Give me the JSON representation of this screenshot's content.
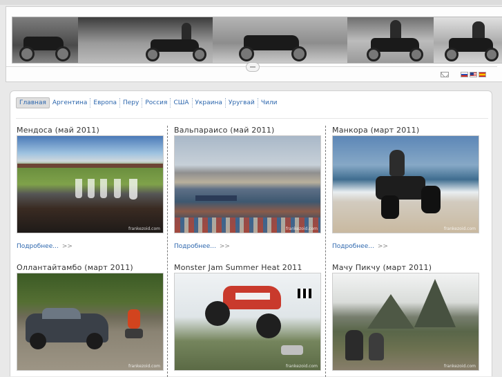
{
  "header": {
    "banner_name": "motorcycle-banner",
    "contact_icon": "mail-icon",
    "languages": [
      "ru",
      "us",
      "es"
    ]
  },
  "nav": {
    "items": [
      {
        "label": "Главная",
        "active": true
      },
      {
        "label": "Аргентина"
      },
      {
        "label": "Европа"
      },
      {
        "label": "Перу"
      },
      {
        "label": "Россия"
      },
      {
        "label": "США"
      },
      {
        "label": "Украина"
      },
      {
        "label": "Уругвай"
      },
      {
        "label": "Чили"
      }
    ]
  },
  "cards": [
    {
      "title": "Мендоса (май 2011)",
      "more": "Подробнее...",
      "arrow": ">>",
      "watermark": "frankezoid.com"
    },
    {
      "title": "Вальпараисо (май 2011)",
      "more": "Подробнее...",
      "arrow": ">>",
      "watermark": "frankezoid.com"
    },
    {
      "title": "Манкора (март 2011)",
      "more": "Подробнее...",
      "arrow": ">>",
      "watermark": "frankezoid.com"
    },
    {
      "title": "Оллантайтамбо (март 2011)",
      "watermark": "frankezoid.com"
    },
    {
      "title": "Monster Jam Summer Heat 2011",
      "watermark": "frankezoid.com"
    },
    {
      "title": "Мачу Пикчу (март 2011)",
      "watermark": "frankezoid.com"
    }
  ]
}
